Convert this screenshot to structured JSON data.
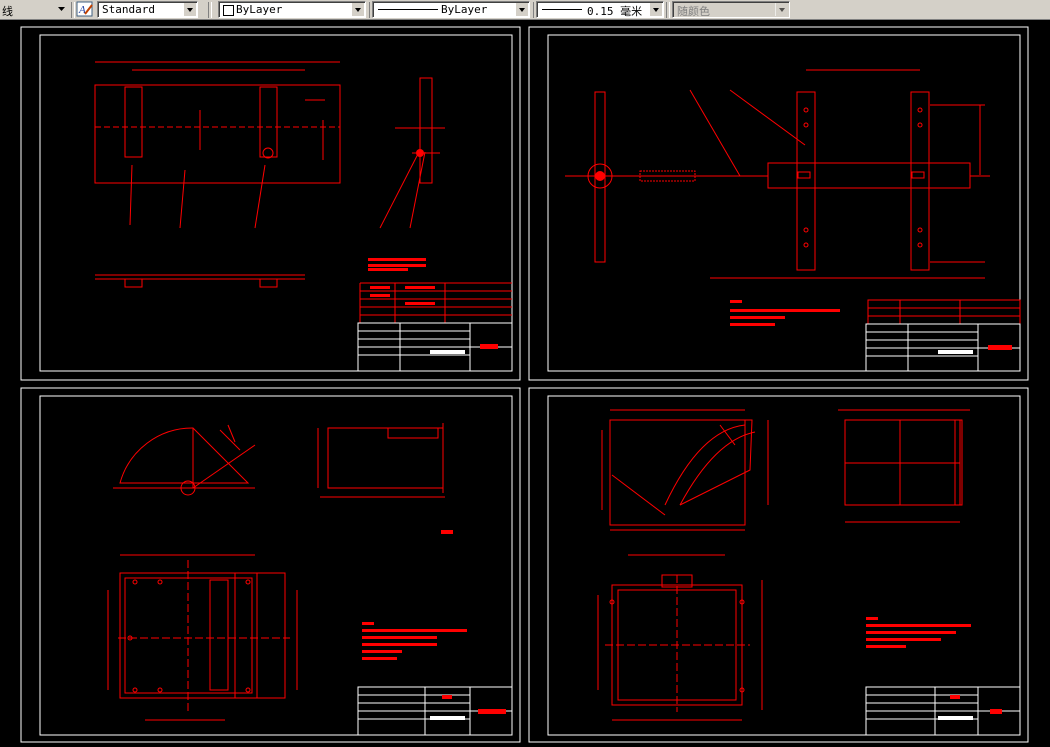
{
  "toolbar": {
    "left_label": "线",
    "text_style": "Standard",
    "layer": "ByLayer",
    "linetype": "ByLayer",
    "lineweight": "0.15 毫米",
    "color": "随颜色"
  },
  "colors": {
    "background": "#000000",
    "drawing": "#ff0000",
    "frame": "#ffffff",
    "toolbar": "#d4d0c8"
  }
}
